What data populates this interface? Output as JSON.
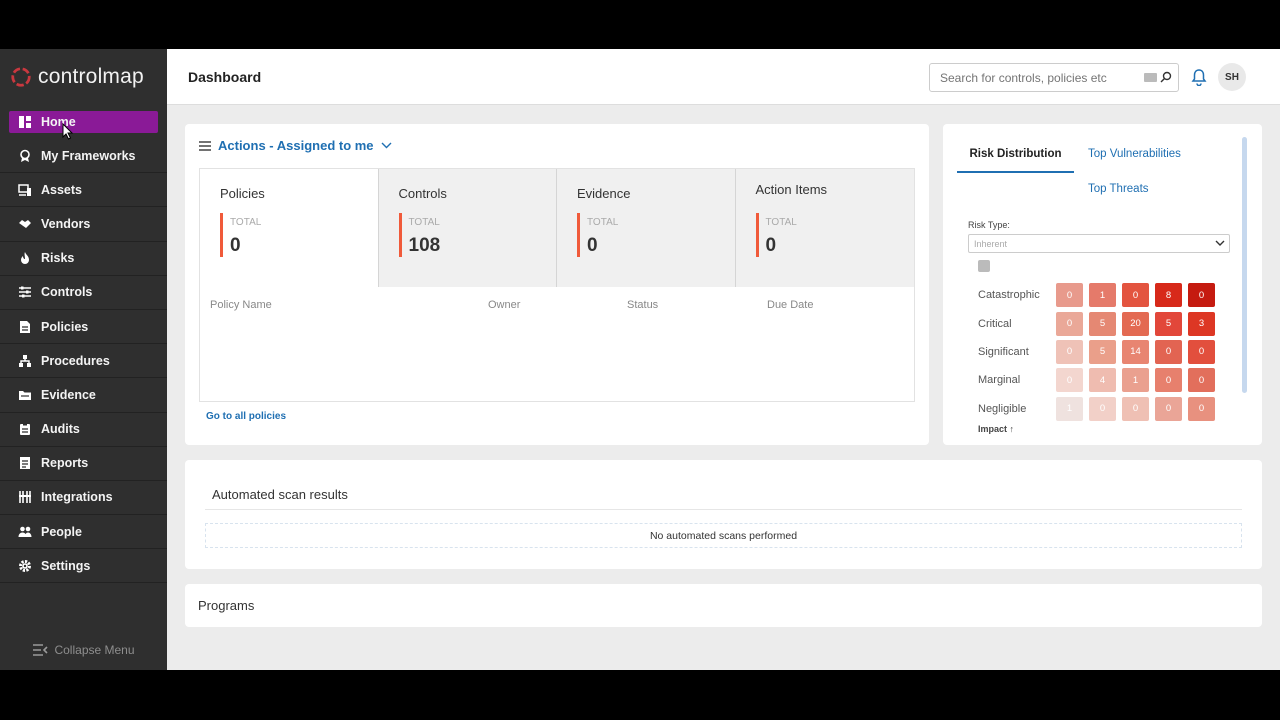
{
  "app": {
    "brand": "controlmap",
    "page_title": "Dashboard"
  },
  "sidebar": {
    "items": [
      {
        "label": "Home",
        "icon": "dashboard-icon",
        "active": true
      },
      {
        "label": "My Frameworks",
        "icon": "badge-icon"
      },
      {
        "label": "Assets",
        "icon": "devices-icon"
      },
      {
        "label": "Vendors",
        "icon": "handshake-icon"
      },
      {
        "label": "Risks",
        "icon": "flame-icon"
      },
      {
        "label": "Controls",
        "icon": "sliders-icon"
      },
      {
        "label": "Policies",
        "icon": "document-icon"
      },
      {
        "label": "Procedures",
        "icon": "hierarchy-icon"
      },
      {
        "label": "Evidence",
        "icon": "folder-icon"
      },
      {
        "label": "Audits",
        "icon": "clipboard-icon"
      },
      {
        "label": "Reports",
        "icon": "report-icon"
      },
      {
        "label": "Integrations",
        "icon": "integrations-icon"
      },
      {
        "label": "People",
        "icon": "people-icon"
      },
      {
        "label": "Settings",
        "icon": "gear-icon"
      }
    ],
    "collapse_label": "Collapse Menu"
  },
  "header": {
    "search_placeholder": "Search for controls, policies etc",
    "avatar_initials": "SH"
  },
  "actions": {
    "title": "Actions - Assigned to me",
    "tiles": [
      {
        "title": "Policies",
        "total_label": "TOTAL",
        "value": "0"
      },
      {
        "title": "Controls",
        "total_label": "TOTAL",
        "value": "108"
      },
      {
        "title": "Evidence",
        "total_label": "TOTAL",
        "value": "0"
      },
      {
        "title": "Action Items",
        "total_label": "TOTAL",
        "value": "0"
      }
    ],
    "columns": [
      "Policy Name",
      "Owner",
      "Status",
      "Due Date"
    ],
    "link": "Go to all policies"
  },
  "risk": {
    "tabs": [
      "Risk Distribution",
      "Top Vulnerabilities",
      "Top Threats"
    ],
    "type_label": "Risk Type:",
    "type_value": "Inherent",
    "impact_label": "Impact ↑",
    "rows": [
      {
        "label": "Catastrophic",
        "values": [
          "0",
          "1",
          "0",
          "8",
          "0"
        ]
      },
      {
        "label": "Critical",
        "values": [
          "0",
          "5",
          "20",
          "5",
          "3"
        ]
      },
      {
        "label": "Significant",
        "values": [
          "0",
          "5",
          "14",
          "0",
          "0"
        ]
      },
      {
        "label": "Marginal",
        "values": [
          "0",
          "4",
          "1",
          "0",
          "0"
        ]
      },
      {
        "label": "Negligible",
        "values": [
          "1",
          "0",
          "0",
          "0",
          "0"
        ]
      }
    ],
    "colors": [
      [
        "#e89a8c",
        "#e57a6a",
        "#e3543f",
        "#d7291a",
        "#c51b10"
      ],
      [
        "#eaa898",
        "#e58873",
        "#e36a52",
        "#e2473a",
        "#dd3724"
      ],
      [
        "#efc2b7",
        "#ea9f8a",
        "#e88571",
        "#e26452",
        "#e24f3d"
      ],
      [
        "#f3d6cf",
        "#efbcb0",
        "#eaa08f",
        "#e7806d",
        "#e26f5c"
      ],
      [
        "#efe2df",
        "#f2d0c8",
        "#efc0b4",
        "#eaa597",
        "#e8917f"
      ]
    ]
  },
  "scans": {
    "title": "Automated scan results",
    "empty": "No automated scans performed"
  },
  "programs": {
    "title": "Programs"
  }
}
